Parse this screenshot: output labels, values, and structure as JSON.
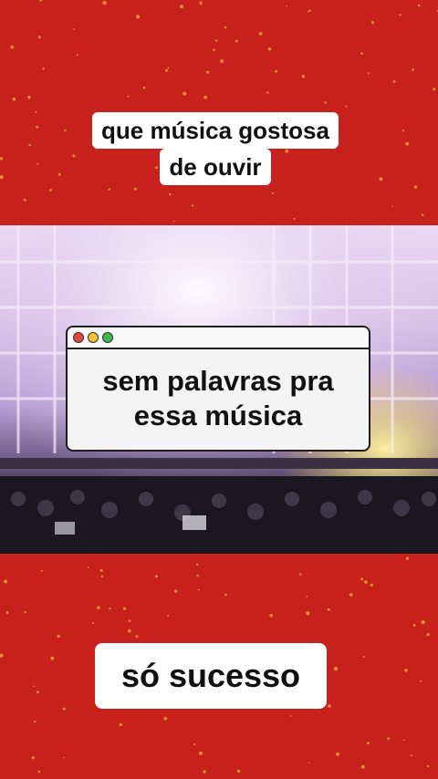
{
  "captions": {
    "top_line1": "que música  gostosa",
    "top_line2": "de ouvir",
    "bottom": "só sucesso"
  },
  "popup": {
    "line1": "sem palavras  pra",
    "line2": "essa música",
    "window_dots": [
      "#e04b3f",
      "#f2c230",
      "#3fb84a"
    ]
  },
  "colors": {
    "background": "#c8211c",
    "speckle": "#f0a040",
    "caption_bg": "#ffffff"
  }
}
